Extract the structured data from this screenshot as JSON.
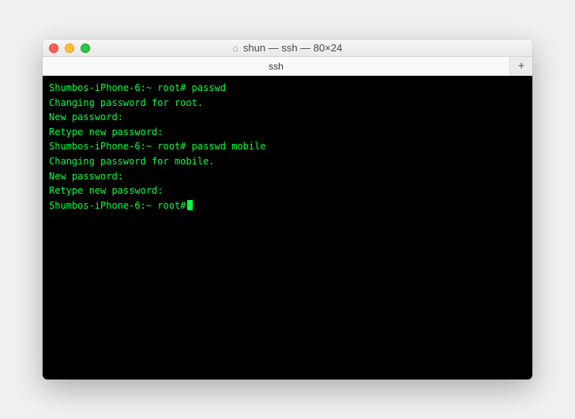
{
  "titlebar": {
    "home_icon": "⌂",
    "title": "shun — ssh — 80×24"
  },
  "tabs": {
    "items": [
      {
        "label": "ssh"
      }
    ],
    "add_label": "+"
  },
  "terminal": {
    "lines": [
      "Shumbos-iPhone-6:~ root# passwd",
      "Changing password for root.",
      "New password:",
      "Retype new password:",
      "Shumbos-iPhone-6:~ root# passwd mobile",
      "Changing password for mobile.",
      "New password:",
      "Retype new password:",
      "Shumbos-iPhone-6:~ root#"
    ]
  },
  "colors": {
    "terminal_bg": "#000000",
    "terminal_fg": "#00ff3c"
  }
}
